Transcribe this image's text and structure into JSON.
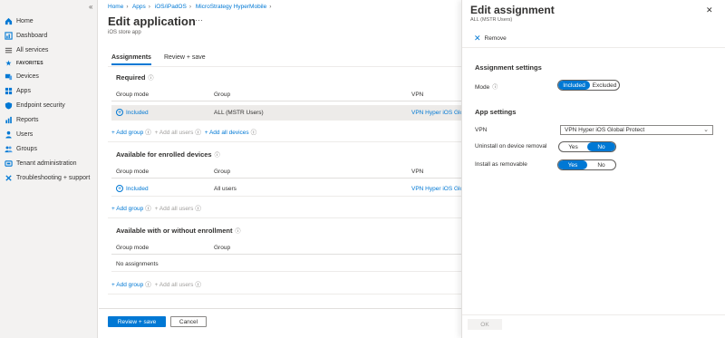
{
  "sidebar": {
    "collapse_icon": "double-chevron-left-icon",
    "items": [
      {
        "label": "Home",
        "icon": "house-icon"
      },
      {
        "label": "Dashboard",
        "icon": "dashboard-icon"
      },
      {
        "label": "All services",
        "icon": "list-icon"
      },
      {
        "label": "FAVORITES",
        "icon": "star-icon"
      },
      {
        "label": "Devices",
        "icon": "devices-icon"
      },
      {
        "label": "Apps",
        "icon": "apps-icon"
      },
      {
        "label": "Endpoint security",
        "icon": "shield-icon"
      },
      {
        "label": "Reports",
        "icon": "reports-icon"
      },
      {
        "label": "Users",
        "icon": "user-icon"
      },
      {
        "label": "Groups",
        "icon": "groups-icon"
      },
      {
        "label": "Tenant administration",
        "icon": "tenant-icon"
      },
      {
        "label": "Troubleshooting + support",
        "icon": "wrench-icon"
      }
    ]
  },
  "main": {
    "breadcrumb": [
      "Home",
      "Apps",
      "iOS/iPadOS",
      "MicroStrategy HyperMobile"
    ],
    "title": "Edit application",
    "more": "···",
    "subtitle": "iOS store app",
    "tabs": [
      "Assignments",
      "Review + save"
    ],
    "required": {
      "title": "Required",
      "headers": [
        "Group mode",
        "Group",
        "VPN"
      ],
      "row": {
        "mode": "Included",
        "group": "ALL (MSTR Users)",
        "vpn": "VPN Hyper iOS Glob"
      },
      "add_group": "+ Add group",
      "add_all_users": "+ Add all users",
      "add_all_devices": "+ Add all devices"
    },
    "enrolled": {
      "title": "Available for enrolled devices",
      "headers": [
        "Group mode",
        "Group",
        "VPN"
      ],
      "row": {
        "mode": "Included",
        "group": "All users",
        "vpn": "VPN Hyper iOS Glob"
      },
      "add_group": "+ Add group",
      "add_all_users": "+ Add all users"
    },
    "without": {
      "title": "Available with or without enrollment",
      "headers": [
        "Group mode",
        "Group"
      ],
      "empty": "No assignments",
      "add_group": "+ Add group",
      "add_all_users": "+ Add all users"
    },
    "footer": {
      "review_save": "Review + save",
      "cancel": "Cancel"
    }
  },
  "panel": {
    "title": "Edit assignment",
    "subtitle": "ALL (MSTR Users)",
    "remove": "Remove",
    "assignment_settings": "Assignment settings",
    "mode_label": "Mode",
    "mode_options": [
      "Included",
      "Excluded"
    ],
    "mode_selected": "Included",
    "app_settings": "App settings",
    "vpn_label": "VPN",
    "vpn_value": "VPN Hyper iOS Global Protect",
    "uninstall_label": "Uninstall on device removal",
    "uninstall_options": [
      "Yes",
      "No"
    ],
    "uninstall_selected": "No",
    "removable_label": "Install as removable",
    "removable_options": [
      "Yes",
      "No"
    ],
    "removable_selected": "Yes",
    "ok": "OK"
  },
  "colors": {
    "accent": "#0078d4",
    "sidebar_bg": "#f3f2f1"
  }
}
